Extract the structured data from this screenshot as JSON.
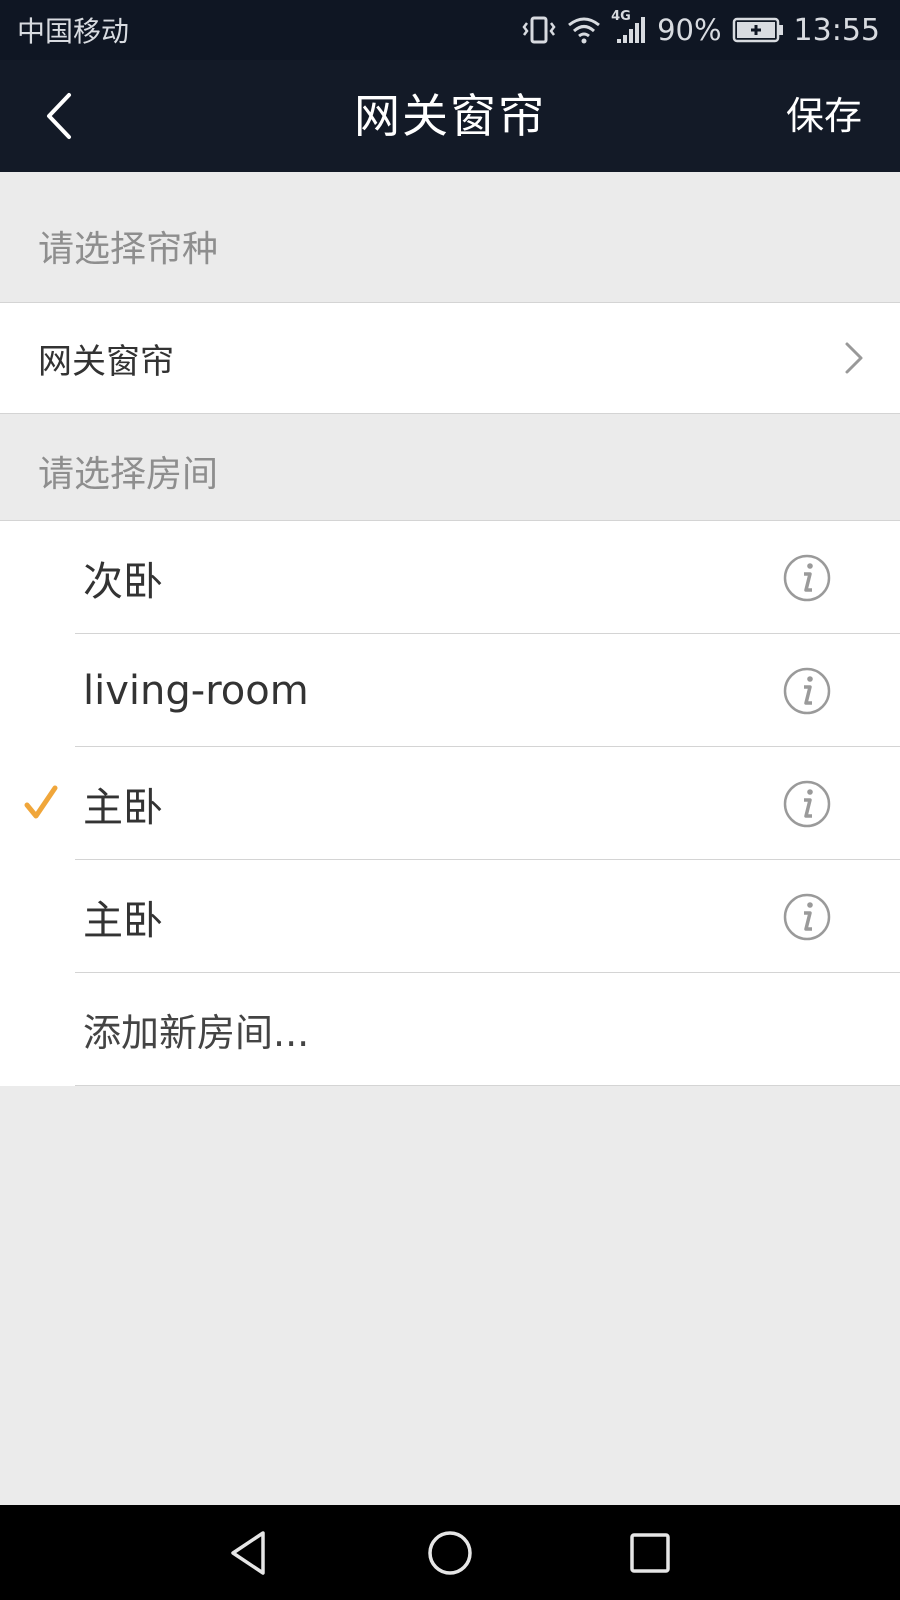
{
  "status_bar": {
    "carrier": "中国移动",
    "network": "4G",
    "battery": "90%",
    "time": "13:55",
    "icons": [
      "vibrate-icon",
      "wifi-icon",
      "signal-icon",
      "battery-icon"
    ]
  },
  "nav": {
    "title": "网关窗帘",
    "save_label": "保存",
    "back_icon": "chevron-left-icon"
  },
  "curtain_section": {
    "header": "请选择帘种",
    "selected_type": "网关窗帘"
  },
  "room_section": {
    "header": "请选择房间",
    "rooms": [
      {
        "name": "次卧",
        "checked": false
      },
      {
        "name": "living-room",
        "checked": false
      },
      {
        "name": "主卧",
        "checked": true
      },
      {
        "name": "主卧",
        "checked": false
      }
    ],
    "add_label": "添加新房间..."
  },
  "colors": {
    "nav_bg": "#131a27",
    "status_bg": "#0f1623",
    "check": "#f0a63a",
    "page_bg": "#ebebeb"
  }
}
